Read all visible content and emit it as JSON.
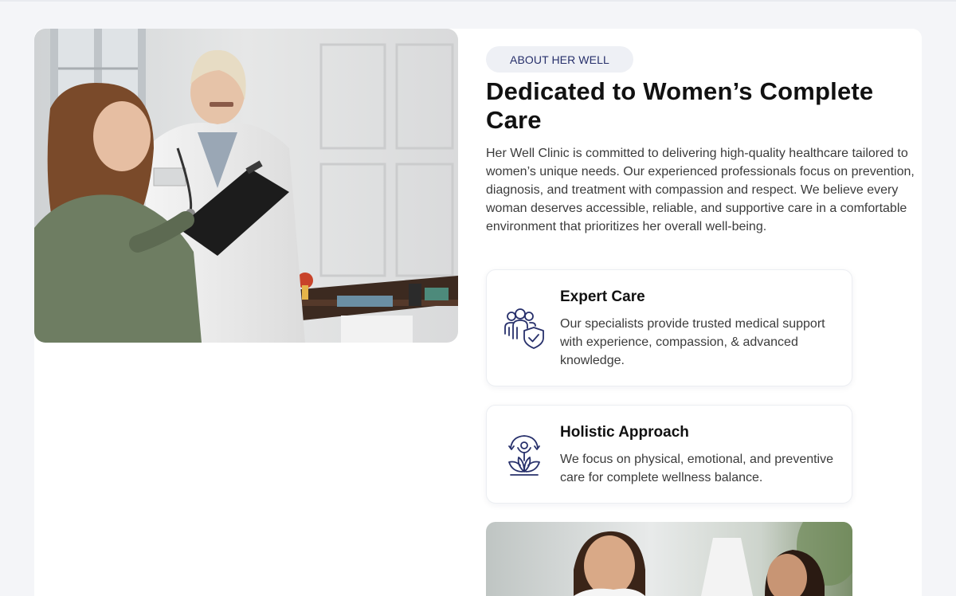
{
  "about": {
    "pill_label": "ABOUT HER WELL",
    "title": "Dedicated to Women’s Complete Care",
    "description": "Her Well Clinic is committed to delivering high-quality healthcare tailored to women’s unique needs. Our experienced professionals focus on prevention, diagnosis, and treatment with compassion and respect. We believe every woman deserves accessible, reliable, and supportive care in a comfortable environment that prioritizes her overall well-being."
  },
  "features": [
    {
      "icon": "team-shield-icon",
      "title": "Expert Care",
      "text": "Our specialists provide trusted medical support with experience, compassion, & advanced knowledge."
    },
    {
      "icon": "lotus-person-icon",
      "title": "Holistic Approach",
      "text": "We focus on physical, emotional, and preventive care for complete wellness balance."
    }
  ],
  "images": {
    "main": "doctor-consultation-photo",
    "secondary": "clinic-staff-photo"
  },
  "colors": {
    "accent": "#27306b",
    "pill_bg": "#eef0f5",
    "page_bg": "#f4f5f8"
  }
}
